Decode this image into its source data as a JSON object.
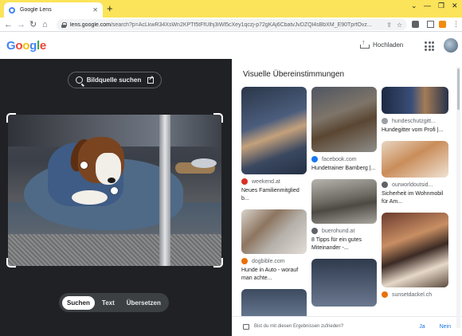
{
  "browser": {
    "tab_title": "Google Lens",
    "url_host": "lens.google.com",
    "url_rest": "/search?p=AcLkwR34XsWn2KPTf5tFfUlhj3iWl5cXey1qczj-p72gKAj6CbatvJvDZQl4sBbXM_E90TprfOvz...",
    "colors": {
      "tabstrip": "#fbe35a"
    }
  },
  "header": {
    "logo_letters": [
      {
        "ch": "G",
        "color": "#4285f4"
      },
      {
        "ch": "o",
        "color": "#ea4335"
      },
      {
        "ch": "o",
        "color": "#fbbc05"
      },
      {
        "ch": "g",
        "color": "#4285f4"
      },
      {
        "ch": "l",
        "color": "#34a853"
      },
      {
        "ch": "e",
        "color": "#ea4335"
      }
    ],
    "upload_label": "Hochladen"
  },
  "left": {
    "source_button_label": "Bildquelle suchen",
    "modes": [
      {
        "label": "Suchen",
        "active": true
      },
      {
        "label": "Text",
        "active": false
      },
      {
        "label": "Übersetzen",
        "active": false
      }
    ]
  },
  "results": {
    "title": "Visuelle Übereinstimmungen",
    "col1": [
      {
        "source": "weekend.at",
        "desc": "Neues Familienmitglied b...",
        "icon_color": "#d93025"
      },
      {
        "source": "dogbible.com",
        "desc": "Hunde in Auto - worauf man achte...",
        "icon_color": "#e8710a"
      }
    ],
    "col2": [
      {
        "source": "facebook.com",
        "desc": "Hundetrainer Bamberg |...",
        "icon_color": "#1877f2"
      },
      {
        "source": "buerohund.at",
        "desc": "8 Tipps für ein gutes Miteinander -...",
        "icon_color": "#5f6368"
      }
    ],
    "col3": [
      {
        "source": "hundeschutzgitt...",
        "desc": "Hundegitter vom Profi |...",
        "icon_color": "#9aa0a6"
      },
      {
        "source": "ourworldoutsid...",
        "desc": "Sicherheit im Wohnmobil für Am...",
        "icon_color": "#5f6368"
      },
      {
        "source": "sunsetdackel.ch",
        "desc": "",
        "icon_color": "#e8710a"
      }
    ]
  },
  "feedback": {
    "question": "Bist du mit diesen Ergebnissen zufrieden?",
    "yes": "Ja",
    "no": "Nein"
  }
}
